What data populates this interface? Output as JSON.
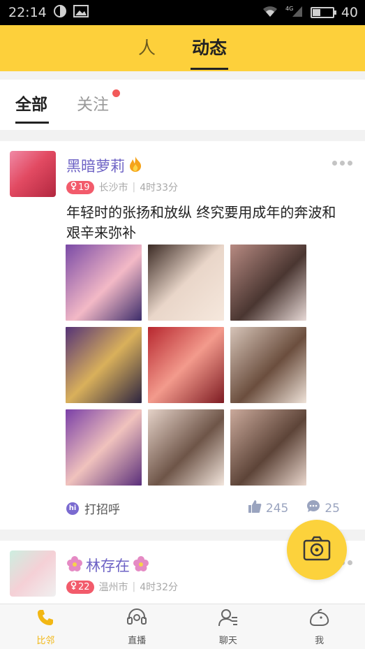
{
  "status_bar": {
    "time": "22:14",
    "signal_label": "4G",
    "battery_text": "40",
    "battery_level_percent": 40
  },
  "top_nav": {
    "tabs": [
      {
        "label": "人",
        "active": false
      },
      {
        "label": "动态",
        "active": true
      }
    ]
  },
  "sub_tabs": {
    "all_label": "全部",
    "follow_label": "关注",
    "follow_has_dot": true
  },
  "posts": [
    {
      "username": "黑暗萝莉",
      "username_suffix_icon": "fire-icon",
      "gender": "female",
      "age": "19",
      "city": "长沙市",
      "time_ago": "4时33分",
      "text": "年轻时的张扬和放纵 终究要用成年的奔波和艰辛来弥补",
      "photo_count": 9,
      "greet_label": "打招呼",
      "likes": "245",
      "comments": "25"
    },
    {
      "username_prefix_icon": "flower-icon",
      "username": "林存在",
      "username_suffix_icon": "flower-icon",
      "gender": "female",
      "age": "22",
      "city": "温州市",
      "time_ago": "4时32分"
    }
  ],
  "bottom_nav": {
    "items": [
      {
        "label": "比邻",
        "icon": "phone-icon",
        "active": true
      },
      {
        "label": "直播",
        "icon": "headset-icon",
        "active": false
      },
      {
        "label": "聊天",
        "icon": "chat-person-icon",
        "active": false
      },
      {
        "label": "我",
        "icon": "bird-icon",
        "active": false
      }
    ]
  },
  "colors": {
    "accent_yellow": "#fdd03b",
    "username_purple": "#6e63c5",
    "badge_red": "#f25b6b",
    "active_nav": "#f2b714"
  }
}
